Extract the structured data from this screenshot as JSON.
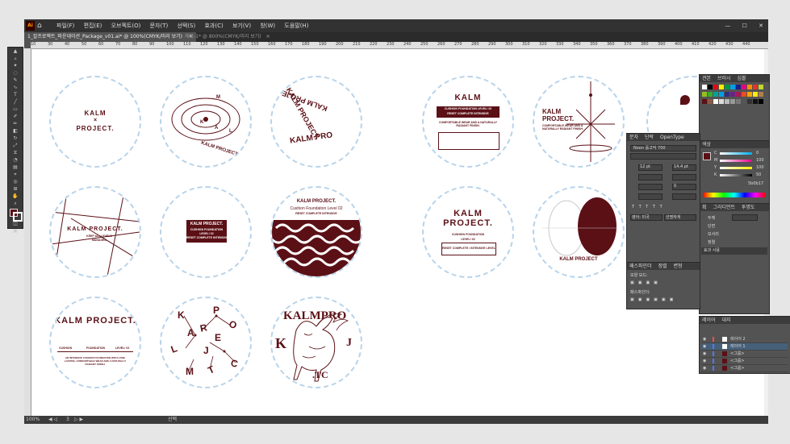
{
  "app": {
    "logo": "Ai",
    "menus": [
      "파일(F)",
      "편집(E)",
      "오브젝트(O)",
      "문자(T)",
      "선택(S)",
      "효과(C)",
      "보기(V)",
      "창(W)",
      "도움말(H)"
    ],
    "window_controls": [
      "—",
      "☐",
      "✕"
    ]
  },
  "tabs": [
    {
      "label": "1_칼프로젝트_파운데이션_Package_v01.ai* @ 100%(CMYK/미리 보기)",
      "close": "✕"
    },
    {
      "label": "제목-1* @ 800%(CMYK/미리 보기)",
      "close": "✕"
    }
  ],
  "ruler_ticks": [
    "10",
    "30",
    "40",
    "50",
    "60",
    "70",
    "80",
    "90",
    "100",
    "110",
    "120",
    "130",
    "140",
    "150",
    "160",
    "170",
    "180",
    "190",
    "200",
    "210",
    "220",
    "230",
    "240",
    "250",
    "260",
    "270",
    "280",
    "290",
    "300",
    "310",
    "320",
    "330",
    "340",
    "350",
    "360",
    "370",
    "380",
    "390",
    "400",
    "410",
    "420",
    "430",
    "440"
  ],
  "status": {
    "zoom": "100%",
    "page": "3",
    "mode": "선택"
  },
  "artwork": {
    "c1": {
      "line1": "KALM",
      "line2": "×",
      "line3": "PROJECT."
    },
    "c2": {
      "letters": [
        "M",
        "K",
        "A",
        "L"
      ],
      "caption": "KALM PROJECT."
    },
    "c3": {
      "line1": "KALM PROJECT.",
      "line2": "KALM PROJECT.",
      "line3": "KALM PRO"
    },
    "c4": {
      "title": "KALM",
      "sub1": "CUSHION FOUNDATION LEVEL! 02",
      "sub2": "RESET COMPLETE INTENSIVE",
      "body": "COMFORTABLE WEAR AND A NATURALLY RADIANT FINISH."
    },
    "c5": {
      "line1": "KALM",
      "line2": "PROJECT.",
      "body": "COMFORTABLE WEAR AND A NATURALLY RADIANT FINISH."
    },
    "c7": {
      "title": "KALM PROJECT.",
      "sub1": "KEEP ALL LEVELS",
      "sub2": "MANAGED"
    },
    "c8": {
      "line1": "KALM PROJECT.",
      "line2": "CUSHION FOUNDATION",
      "line3": "LEVEL! 02",
      "line4": "RESET COMPLETE INTENSIVE"
    },
    "c9": {
      "title": "KALM PROJECT.",
      "sub1": "Cushion Foundation Level 02",
      "sub2": "RESET COMPLETE INTENSIVE"
    },
    "c10": {
      "line1": "KALM",
      "line2": "PROJECT.",
      "sub1": "CUSHION FOUNDATION",
      "sub2": "LEVEL! 02",
      "sub3": "RESET COMPLETE / INTENSIVE LEVEL"
    },
    "c11": {
      "caption": "KALM PROJECT"
    },
    "c12": {
      "arc": "KALM PROJECT.",
      "sub1": "CUSHION",
      "sub2": "FOUNDATION",
      "sub3": "LEVEL! 02",
      "body": "AN INTENSIVE CUSHION FOUNDATION WITH LONG LASTING, COMFORTABLE WEAR AND A NATURALLY RADIANT FINISH."
    },
    "c13": {
      "letters": [
        "K",
        "A",
        "R",
        "P",
        "O",
        "E",
        "L",
        "J",
        "C",
        "T",
        "M"
      ]
    },
    "c14": {
      "line1": "KALMPRO",
      "line2": "K",
      "line3": "J",
      "line4": ".TC"
    }
  },
  "panels": {
    "color": {
      "tabs": [
        "견본",
        "브러시",
        "심볼"
      ]
    },
    "color2": {
      "tabs": [
        "색상"
      ],
      "labels": [
        "C",
        "M",
        "Y",
        "K"
      ],
      "values": [
        "0",
        "100",
        "100",
        "50"
      ],
      "hex": "5b0b17"
    },
    "character": {
      "tabs": [
        "문자",
        "단락",
        "OpenType"
      ],
      "font": "Noon 흘고딕 700",
      "size": "12 pt",
      "leading": "14.4 pt",
      "tracking": "0",
      "language": "영어: 미국",
      "aa": "선명하게"
    },
    "properties": {
      "tabs": [
        "획",
        "그라디언트",
        "투명도"
      ],
      "labels": [
        "두께",
        "단면",
        "모서리",
        "정렬"
      ]
    },
    "pathfinder": {
      "tabs": [
        "패스파인더",
        "정렬",
        "변형"
      ],
      "label1": "모양 모드:",
      "label2": "패스파인더:"
    },
    "appearance": {
      "tabs": [
        "효과 사용"
      ]
    },
    "layers": {
      "tabs": [
        "레이어",
        "대지"
      ],
      "rows": [
        "레이어 2",
        "레이어 1",
        "<그룹>",
        "<그룹>",
        "<그룹>"
      ]
    }
  },
  "colors": {
    "accent": "#5b1016",
    "guide": "#b8d3ea"
  }
}
